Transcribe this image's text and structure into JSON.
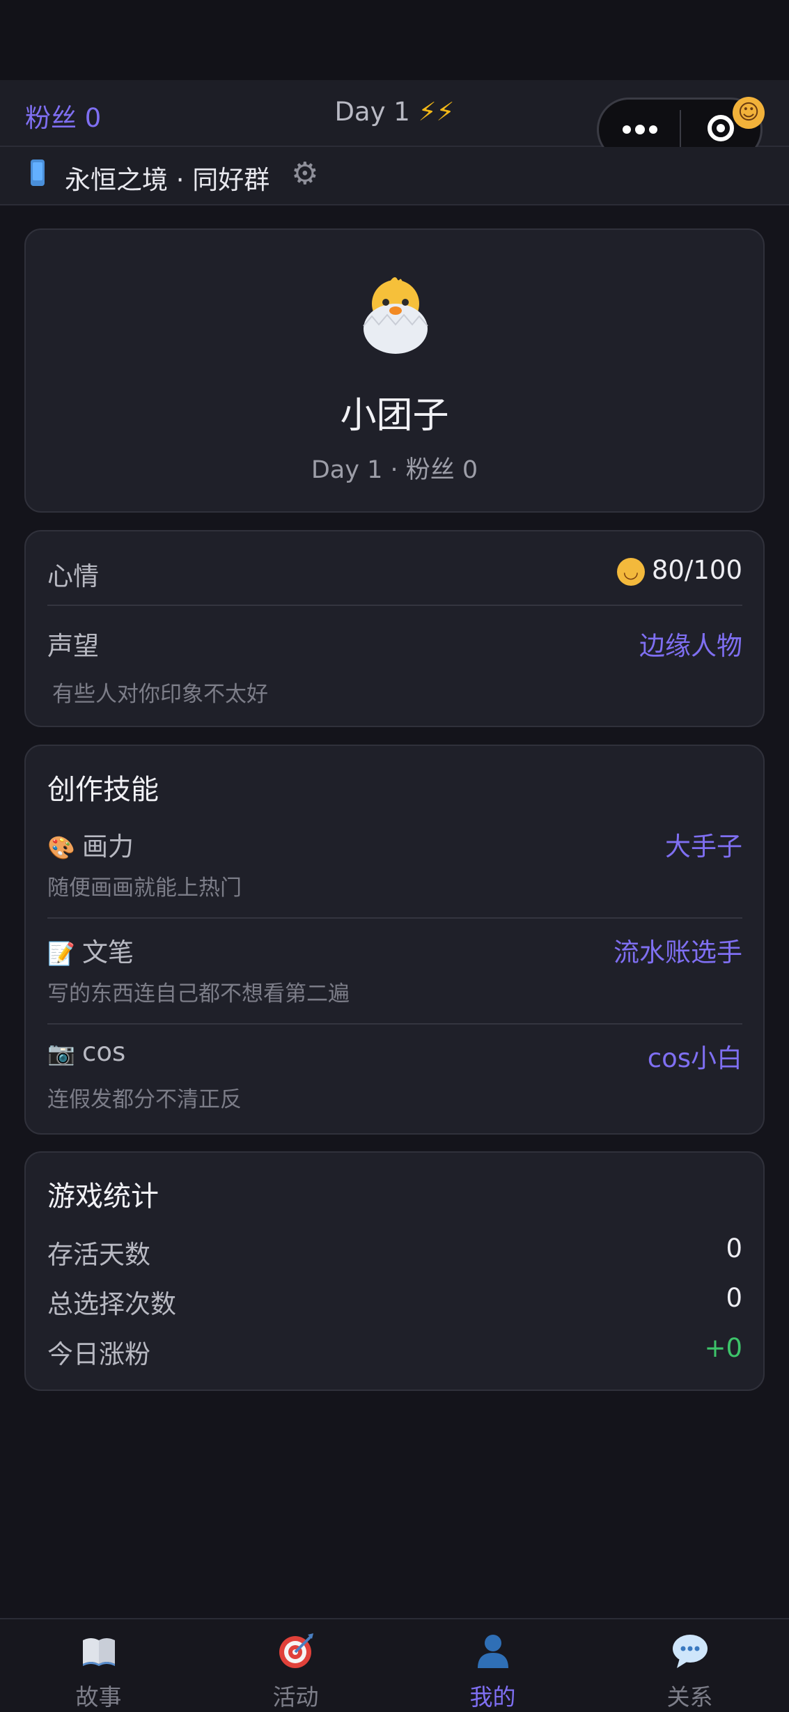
{
  "header": {
    "fans": "粉丝 0",
    "day": "Day 1",
    "bolts": "⚡⚡"
  },
  "group": {
    "name": "永恒之境 · 同好群"
  },
  "profile": {
    "name": "小团子",
    "sub": "Day 1 · 粉丝 0"
  },
  "stats": {
    "mood_label": "心情",
    "mood_value": "80/100",
    "reputation_label": "声望",
    "reputation_value": "边缘人物",
    "reputation_hint": "有些人对你印象不太好"
  },
  "skills": {
    "title": "创作技能",
    "items": [
      {
        "emoji": "🎨",
        "name": "画力",
        "level": "大手子",
        "desc": "随便画画就能上热门"
      },
      {
        "emoji": "📝",
        "name": "文笔",
        "level": "流水账选手",
        "desc": "写的东西连自己都不想看第二遍"
      },
      {
        "emoji": "📷",
        "name": "cos",
        "level": "cos小白",
        "desc": "连假发都分不清正反"
      }
    ]
  },
  "game_stats": {
    "title": "游戏统计",
    "rows": [
      {
        "label": "存活天数",
        "value": "0"
      },
      {
        "label": "总选择次数",
        "value": "0"
      },
      {
        "label": "今日涨粉",
        "value": "+0"
      }
    ]
  },
  "tabs": [
    {
      "label": "故事",
      "icon": "book-icon"
    },
    {
      "label": "活动",
      "icon": "target-icon"
    },
    {
      "label": "我的",
      "icon": "user-icon"
    },
    {
      "label": "关系",
      "icon": "chat-bubble-icon"
    }
  ],
  "colors": {
    "accent": "#7f6ff2",
    "positive": "#3dc46a",
    "background": "#14141b",
    "card": "#1f2029"
  }
}
